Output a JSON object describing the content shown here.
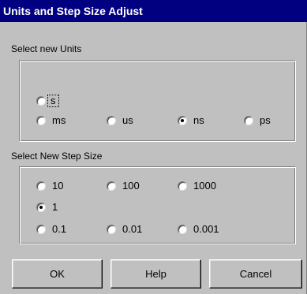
{
  "window": {
    "title": "Units and Step Size Adjust"
  },
  "units_section": {
    "label": "Select new Units",
    "options": [
      {
        "label": "s",
        "checked": false,
        "focused": true
      },
      {
        "label": "ms",
        "checked": false
      },
      {
        "label": "us",
        "checked": false
      },
      {
        "label": "ns",
        "checked": true
      },
      {
        "label": "ps",
        "checked": false
      }
    ]
  },
  "step_section": {
    "label": "Select New Step Size",
    "options": [
      {
        "label": "10",
        "checked": false
      },
      {
        "label": "100",
        "checked": false
      },
      {
        "label": "1000",
        "checked": false
      },
      {
        "label": "1",
        "checked": true
      },
      {
        "label": "0.1",
        "checked": false
      },
      {
        "label": "0.01",
        "checked": false
      },
      {
        "label": "0.001",
        "checked": false
      }
    ]
  },
  "buttons": {
    "ok": "OK",
    "help": "Help",
    "cancel": "Cancel"
  },
  "colors": {
    "titlebar_bg": "#000080",
    "titlebar_text": "#ffffff",
    "face": "#c0c0c0"
  }
}
